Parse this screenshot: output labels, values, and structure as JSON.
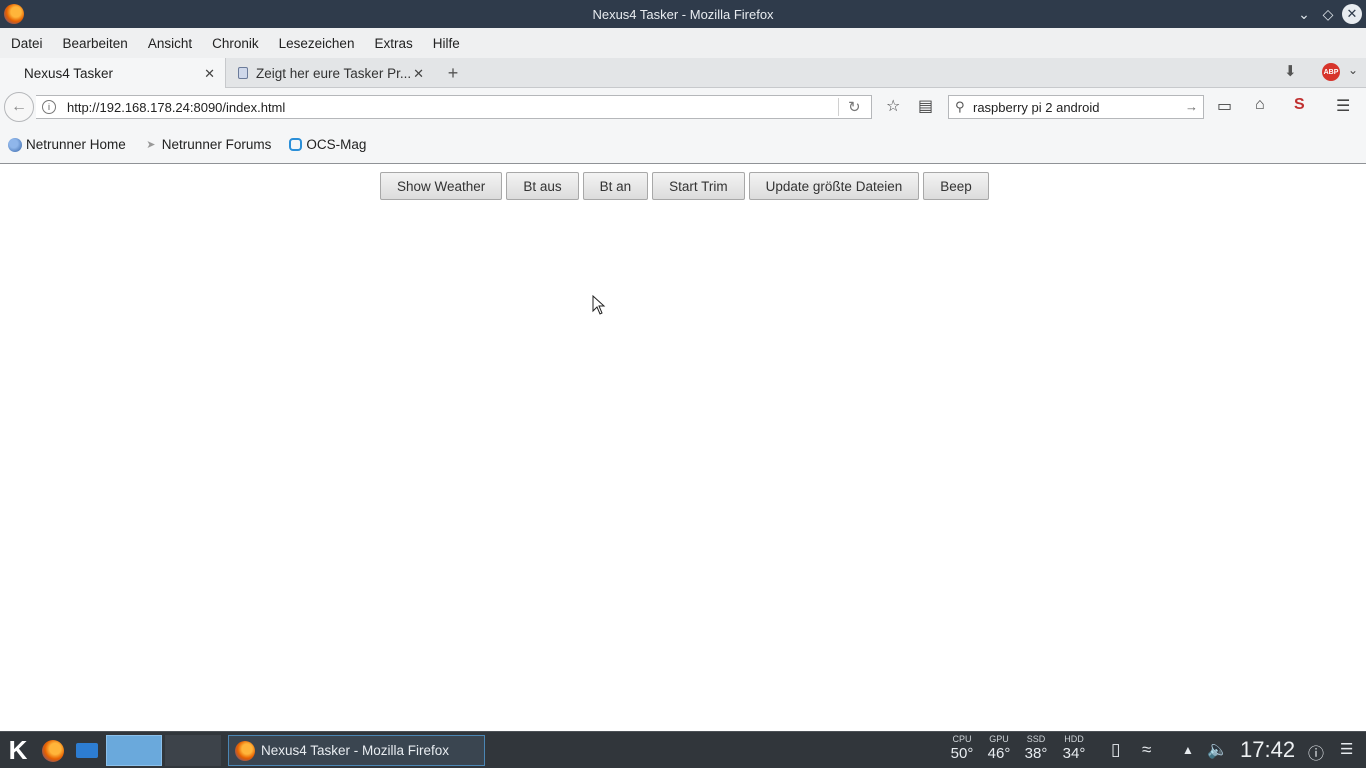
{
  "window": {
    "title": "Nexus4 Tasker - Mozilla Firefox"
  },
  "menu": {
    "items": [
      {
        "label": "Datei"
      },
      {
        "label": "Bearbeiten"
      },
      {
        "label": "Ansicht"
      },
      {
        "label": "Chronik"
      },
      {
        "label": "Lesezeichen"
      },
      {
        "label": "Extras"
      },
      {
        "label": "Hilfe"
      }
    ]
  },
  "tabs": [
    {
      "label": "Nexus4 Tasker"
    },
    {
      "label": "Zeigt her eure Tasker Pr..."
    }
  ],
  "nav": {
    "url": "http://192.168.178.24:8090/index.html",
    "search_value": "raspberry pi 2 android",
    "abp_label": "ABP"
  },
  "bookmarks": [
    {
      "label": "Netrunner Home"
    },
    {
      "label": "Netrunner Forums"
    },
    {
      "label": "OCS-Mag"
    }
  ],
  "page": {
    "buttons": [
      {
        "label": "Show Weather"
      },
      {
        "label": "Bt aus"
      },
      {
        "label": "Bt an"
      },
      {
        "label": "Start Trim"
      },
      {
        "label": "Update größte Dateien"
      },
      {
        "label": "Beep"
      }
    ]
  },
  "taskbar": {
    "task_label": "Nexus4 Tasker - Mozilla Firefox",
    "sensors": [
      {
        "label": "CPU",
        "value": "50°"
      },
      {
        "label": "GPU",
        "value": "46°"
      },
      {
        "label": "SSD",
        "value": "38°"
      },
      {
        "label": "HDD",
        "value": "34°"
      }
    ],
    "clock": "17:42"
  }
}
